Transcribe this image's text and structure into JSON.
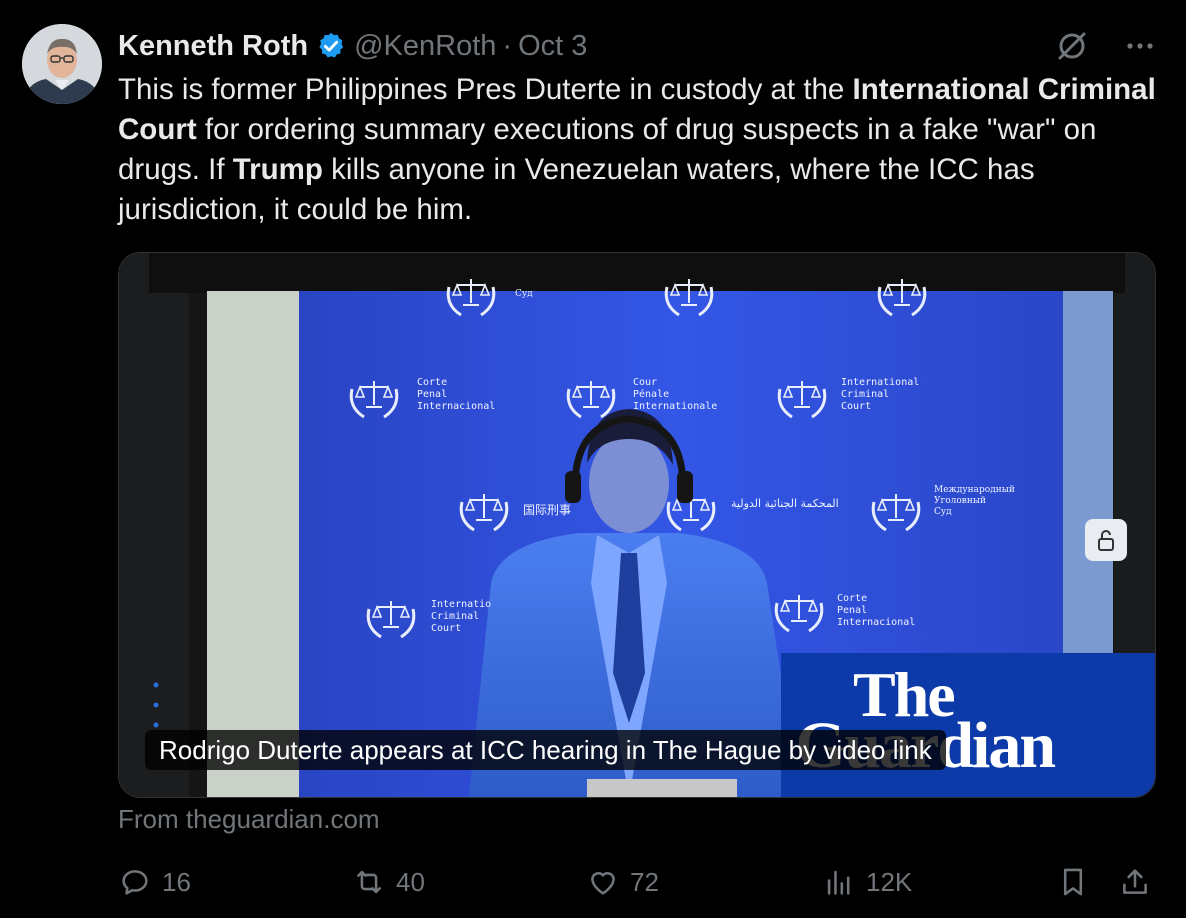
{
  "tweet": {
    "author_name": "Kenneth Roth",
    "handle": "@KenRoth",
    "separator": "·",
    "date": "Oct 3",
    "text_parts": [
      {
        "t": "This is former Philippines Pres Duterte in custody at the ",
        "b": false
      },
      {
        "t": "International Criminal Court",
        "b": true
      },
      {
        "t": " for ordering summary executions of drug suspects in a fake \"war\" on drugs. If ",
        "b": false
      },
      {
        "t": "Trump",
        "b": true
      },
      {
        "t": " kills anyone in Venezuelan waters, where the ICC has jurisdiction, it could be him.",
        "b": false
      }
    ]
  },
  "media": {
    "caption": "Rodrigo Duterte appears at ICC hearing in The Hague by video link",
    "logo_line1": "The",
    "logo_line2": "Guardian",
    "backdrop": {
      "es": [
        "Corte",
        "Penal",
        "Internacional"
      ],
      "fr": [
        "Cour",
        "Pénale",
        "Internationale"
      ],
      "en": [
        "International",
        "Criminal",
        "Court"
      ],
      "zh": "国际刑事",
      "ar": "المحكمة الجنائية الدولية",
      "ru": [
        "Международный",
        "Уголовный",
        "Суд"
      ],
      "en_cut": [
        "Internatio",
        "Criminal",
        "Court"
      ],
      "es2": [
        "Corte",
        "Penal",
        "Internacional"
      ],
      "top_fragment": "Суд"
    }
  },
  "source": "From theguardian.com",
  "stats": {
    "replies": "16",
    "reposts": "40",
    "likes": "72",
    "views": "12K"
  },
  "colors": {
    "background": "#000000",
    "text": "#e7e9ea",
    "muted": "#71767b",
    "verified": "#1d9bf0",
    "backdrop_blue": "#2f4fd8",
    "guardian_blue": "#0d3aa9"
  },
  "icons": {
    "grok": "slashed-circle-icon",
    "more": "more-dots-icon",
    "reply": "reply-icon",
    "repost": "repost-icon",
    "like": "heart-icon",
    "views": "views-icon",
    "bookmark": "bookmark-icon",
    "share": "share-icon"
  }
}
